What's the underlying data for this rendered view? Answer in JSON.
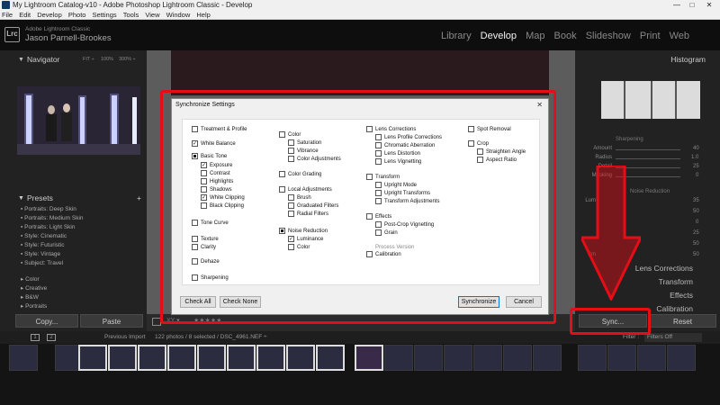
{
  "window": {
    "title": "My Lightroom Catalog-v10 - Adobe Photoshop Lightroom Classic - Develop",
    "controls": [
      "—",
      "□",
      "✕"
    ]
  },
  "menu": [
    "File",
    "Edit",
    "Develop",
    "Photo",
    "Settings",
    "Tools",
    "View",
    "Window",
    "Help"
  ],
  "identity": {
    "logo": "Lrc",
    "app_name": "Adobe Lightroom Classic",
    "user_name": "Jason Parnell-Brookes"
  },
  "modules": [
    {
      "label": "Library",
      "active": false
    },
    {
      "label": "Develop",
      "active": true
    },
    {
      "label": "Map",
      "active": false
    },
    {
      "label": "Book",
      "active": false
    },
    {
      "label": "Slideshow",
      "active": false
    },
    {
      "label": "Print",
      "active": false
    },
    {
      "label": "Web",
      "active": false
    }
  ],
  "navigator": {
    "title": "Navigator",
    "zoom_options": [
      "FIT ÷",
      "100%",
      "300% ÷"
    ]
  },
  "presets": {
    "title": "Presets",
    "add": "+",
    "items": [
      "Portraits: Deep Skin",
      "Portraits: Medium Skin",
      "Portraits: Light Skin",
      "Style: Cinematic",
      "Style: Futuristic",
      "Style: Vintage",
      "Subject: Travel"
    ],
    "groups": [
      "Color",
      "Creative",
      "B&W",
      "Portraits"
    ]
  },
  "left_buttons": {
    "copy": "Copy...",
    "paste": "Paste"
  },
  "right_panel": {
    "histogram_title": "Histogram",
    "sharpening_title": "Sharpening",
    "sliders": [
      {
        "label": "Amount",
        "value": "40"
      },
      {
        "label": "Radius",
        "value": "1.0"
      },
      {
        "label": "Detail",
        "value": "25"
      },
      {
        "label": "Masking",
        "value": "0"
      }
    ],
    "noise_title": "Noise Reduction",
    "noise_sliders": [
      {
        "label": "Lum",
        "value": "35"
      },
      {
        "label": "",
        "value": "50"
      },
      {
        "label": "",
        "value": "0"
      },
      {
        "label": "",
        "value": "25"
      },
      {
        "label": "",
        "value": "50"
      },
      {
        "label": "Sm",
        "value": "50"
      }
    ],
    "sections": [
      "Lens Corrections",
      "Transform",
      "Effects",
      "Calibration"
    ],
    "sync_button": "Sync...",
    "reset_button": "Reset"
  },
  "filmstrip_bar": {
    "pages": [
      "1",
      "2"
    ],
    "source": "Previous Import",
    "count": "122 photos / 8 selected / DSC_4961.NEF ÷",
    "filter_label": "Filter :",
    "filter_value": "Filters Off"
  },
  "dialog": {
    "title": "Synchronize Settings",
    "close": "✕",
    "col1": [
      {
        "label": "Treatment & Profile",
        "checked": false,
        "indent": 0,
        "group": true
      },
      {
        "label": "White Balance",
        "checked": true,
        "indent": 0,
        "group": true
      },
      {
        "label": "Basic Tone",
        "checked": true,
        "indent": 0,
        "group": true,
        "square": true
      },
      {
        "label": "Exposure",
        "checked": true,
        "indent": 1
      },
      {
        "label": "Contrast",
        "checked": false,
        "indent": 1
      },
      {
        "label": "Highlights",
        "checked": false,
        "indent": 1
      },
      {
        "label": "Shadows",
        "checked": false,
        "indent": 1
      },
      {
        "label": "White Clipping",
        "checked": true,
        "indent": 1
      },
      {
        "label": "Black Clipping",
        "checked": false,
        "indent": 1
      },
      {
        "label": "Tone Curve",
        "checked": false,
        "indent": 0,
        "group": true
      },
      {
        "label": "Texture",
        "checked": false,
        "indent": 0,
        "group": true
      },
      {
        "label": "Clarity",
        "checked": false,
        "indent": 0
      },
      {
        "label": "Dehaze",
        "checked": false,
        "indent": 0,
        "group": true
      },
      {
        "label": "Sharpening",
        "checked": false,
        "indent": 0,
        "group": true
      }
    ],
    "col2": [
      {
        "label": "Color",
        "checked": false,
        "indent": 0,
        "group": true
      },
      {
        "label": "Saturation",
        "checked": false,
        "indent": 1
      },
      {
        "label": "Vibrance",
        "checked": false,
        "indent": 1
      },
      {
        "label": "Color Adjustments",
        "checked": false,
        "indent": 1
      },
      {
        "label": "Color Grading",
        "checked": false,
        "indent": 0,
        "group": true
      },
      {
        "label": "Local Adjustments",
        "checked": false,
        "indent": 0,
        "group": true
      },
      {
        "label": "Brush",
        "checked": false,
        "indent": 1
      },
      {
        "label": "Graduated Filters",
        "checked": false,
        "indent": 1
      },
      {
        "label": "Radial Filters",
        "checked": false,
        "indent": 1
      },
      {
        "label": "Noise Reduction",
        "checked": true,
        "indent": 0,
        "group": true,
        "square": true
      },
      {
        "label": "Luminance",
        "checked": true,
        "indent": 1
      },
      {
        "label": "Color",
        "checked": false,
        "indent": 1
      }
    ],
    "col3": [
      {
        "label": "Lens Corrections",
        "checked": false,
        "indent": 0,
        "group": true
      },
      {
        "label": "Lens Profile Corrections",
        "checked": false,
        "indent": 1
      },
      {
        "label": "Chromatic Aberration",
        "checked": false,
        "indent": 1
      },
      {
        "label": "Lens Distortion",
        "checked": false,
        "indent": 1
      },
      {
        "label": "Lens Vignetting",
        "checked": false,
        "indent": 1
      },
      {
        "label": "Transform",
        "checked": false,
        "indent": 0,
        "group": true
      },
      {
        "label": "Upright Mode",
        "checked": false,
        "indent": 1
      },
      {
        "label": "Upright Transforms",
        "checked": false,
        "indent": 1
      },
      {
        "label": "Transform Adjustments",
        "checked": false,
        "indent": 1
      },
      {
        "label": "Effects",
        "checked": false,
        "indent": 0,
        "group": true
      },
      {
        "label": "Post-Crop Vignetting",
        "checked": false,
        "indent": 1
      },
      {
        "label": "Grain",
        "checked": false,
        "indent": 1
      },
      {
        "label": "Process Version",
        "checked": false,
        "indent": 0,
        "disabled": true
      },
      {
        "label": "Calibration",
        "checked": false,
        "indent": 0
      }
    ],
    "col4": [
      {
        "label": "Spot Removal",
        "checked": false,
        "indent": 0,
        "group": true
      },
      {
        "label": "Crop",
        "checked": false,
        "indent": 0,
        "group": true
      },
      {
        "label": "Straighten Angle",
        "checked": false,
        "indent": 1
      },
      {
        "label": "Aspect Ratio",
        "checked": false,
        "indent": 1
      }
    ],
    "check_all": "Check All",
    "check_none": "Check None",
    "synchronize": "Synchronize",
    "cancel": "Cancel"
  },
  "colors": {
    "highlight": "#e50e16",
    "panel_bg": "#222222",
    "dialog_bg": "#f0f0f0"
  }
}
